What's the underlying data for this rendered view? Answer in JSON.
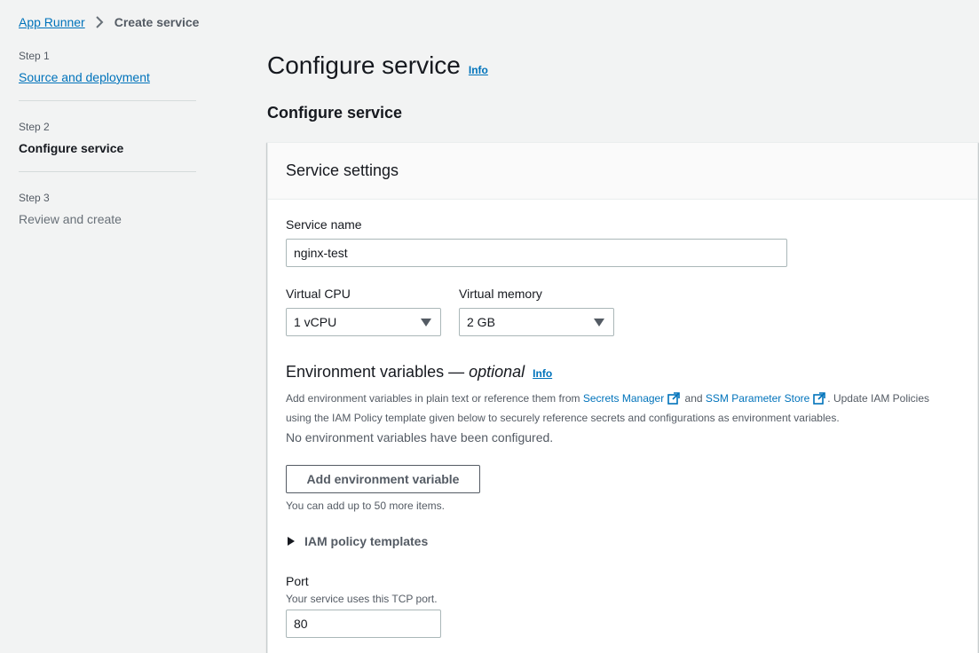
{
  "breadcrumb": {
    "items": [
      "App Runner"
    ],
    "current": "Create service"
  },
  "steps": [
    {
      "num": "Step 1",
      "label": "Source and deployment",
      "state": "link"
    },
    {
      "num": "Step 2",
      "label": "Configure service",
      "state": "active"
    },
    {
      "num": "Step 3",
      "label": "Review and create",
      "state": "disabled"
    }
  ],
  "page": {
    "title": "Configure service",
    "info": "Info",
    "section_title": "Configure service"
  },
  "service_settings": {
    "header": "Service settings",
    "service_name_label": "Service name",
    "service_name_value": "nginx-test",
    "vcpu_label": "Virtual CPU",
    "vcpu_value": "1 vCPU",
    "memory_label": "Virtual memory",
    "memory_value": "2 GB"
  },
  "env": {
    "title": "Environment variables —",
    "optional": "optional",
    "info": "Info",
    "desc_1": "Add environment variables in plain text or reference them from ",
    "secrets_link": "Secrets Manager",
    "and": " and ",
    "ssm_link": "SSM Parameter Store",
    "desc_2": ". Update IAM Policies using the IAM Policy template given below to securely reference secrets and configurations as environment variables.",
    "empty": "No environment variables have been configured.",
    "add_button": "Add environment variable",
    "limit_hint": "You can add up to 50 more items.",
    "iam_expander": "IAM policy templates"
  },
  "port": {
    "label": "Port",
    "desc": "Your service uses this TCP port.",
    "value": "80"
  },
  "colors": {
    "link": "#0073bb",
    "background": "#f2f3f3",
    "text": "#16191f",
    "muted": "#545b64"
  }
}
